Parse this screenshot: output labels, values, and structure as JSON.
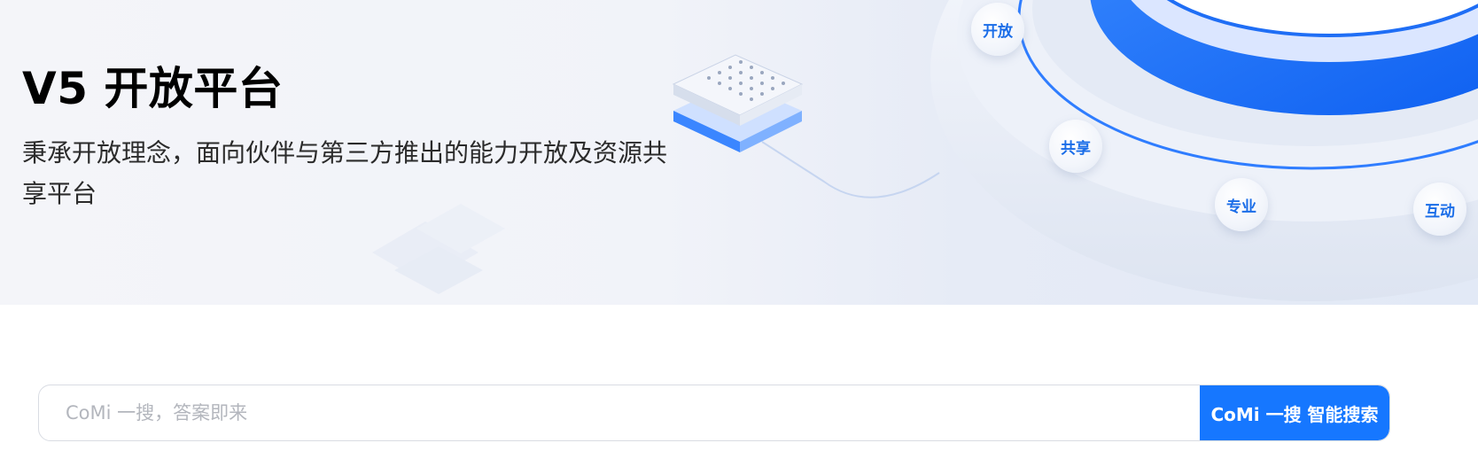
{
  "hero": {
    "title": "V5 开放平台",
    "subtitle": "秉承开放理念，面向伙伴与第三方推出的能力开放及资源共享平台",
    "tags": [
      "开放",
      "共享",
      "专业",
      "互动"
    ]
  },
  "search": {
    "placeholder": "CoMi 一搜，答案即来",
    "button_label": "CoMi 一搜 智能搜索"
  },
  "colors": {
    "accent": "#1677ff",
    "tag_text": "#1a6de8",
    "hero_bg": "#f1f3f9"
  }
}
